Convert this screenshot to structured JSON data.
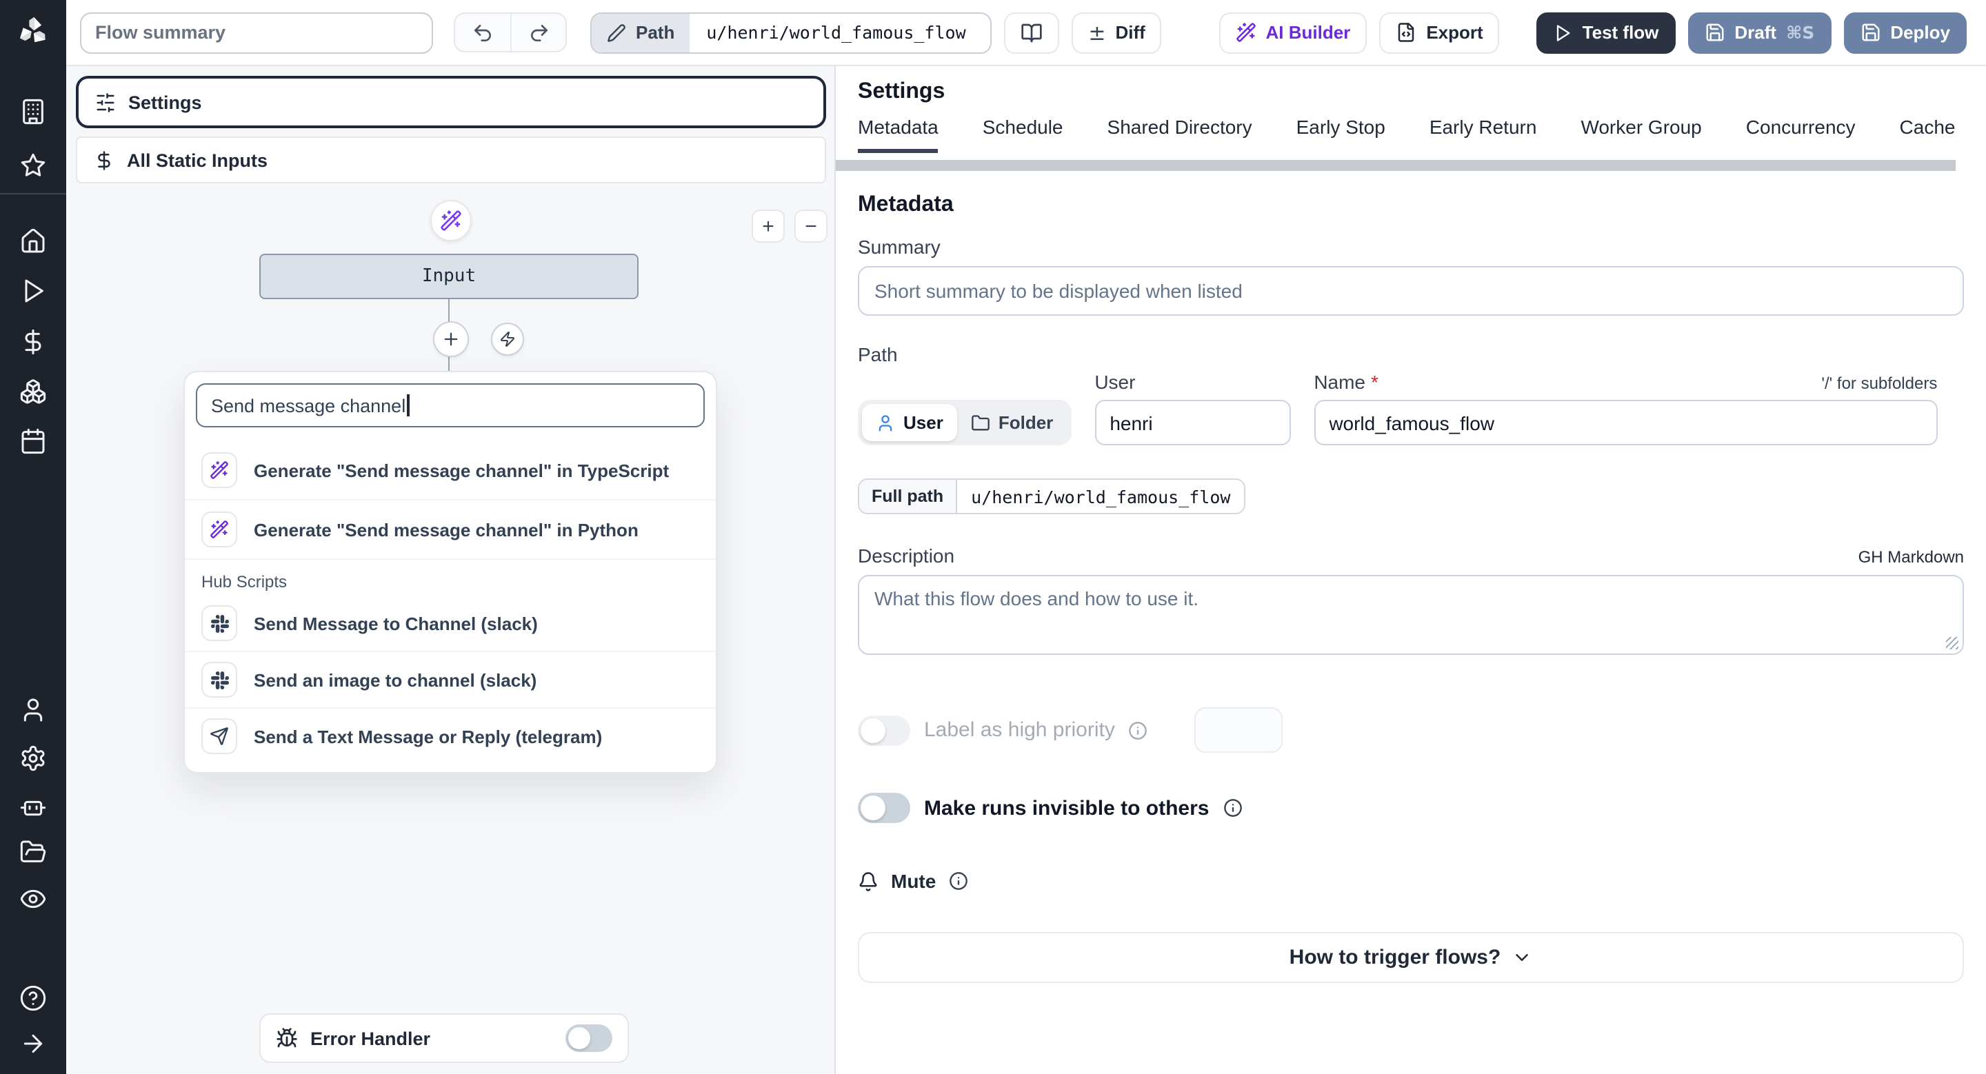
{
  "colors": {
    "sidebar_bg": "#1e232b",
    "canvas_bg": "#f6f7f9",
    "accent_purple": "#6d28d9",
    "primary_dark_button": "#2b3342",
    "slate_button": "#6b82a6",
    "selected_node_border": "#1e293b",
    "input_node_fill": "#dbe1e9"
  },
  "sidebar": {
    "icons": [
      "windmill-logo",
      "building",
      "star",
      "home",
      "play",
      "dollar",
      "boxes",
      "calendar",
      "user",
      "settings-gear",
      "bot",
      "folder-open",
      "eye",
      "help-circle",
      "expand-arrow"
    ]
  },
  "topbar": {
    "flow_summary_placeholder": "Flow summary",
    "path_label": "Path",
    "path_value": "u/henri/world_famous_flow",
    "diff_icon": "±",
    "diff_label": "Diff",
    "ai_builder_label": "AI Builder",
    "export_label": "Export",
    "test_flow_label": "Test flow",
    "draft_label": "Draft",
    "draft_shortcut": "⌘S",
    "deploy_label": "Deploy"
  },
  "flow_editor": {
    "settings_label": "Settings",
    "static_inputs_label": "All Static Inputs",
    "input_node_label": "Input",
    "zoom_in": "+",
    "zoom_out": "−",
    "search_value": "Send message channel",
    "results": [
      {
        "label": "Generate \"Send message channel\" in TypeScript",
        "icon": "wand-sparkles"
      },
      {
        "label": "Generate \"Send message channel\" in Python",
        "icon": "wand-sparkles"
      }
    ],
    "hub_section_label": "Hub Scripts",
    "hub_results": [
      {
        "label": "Send Message to Channel (slack)",
        "icon": "slack"
      },
      {
        "label": "Send an image to channel (slack)",
        "icon": "slack"
      },
      {
        "label": "Send a Text Message or Reply (telegram)",
        "icon": "send"
      }
    ],
    "error_handler_label": "Error Handler"
  },
  "settings_panel": {
    "title": "Settings",
    "tabs": [
      "Metadata",
      "Schedule",
      "Shared Directory",
      "Early Stop",
      "Early Return",
      "Worker Group",
      "Concurrency",
      "Cache"
    ],
    "active_tab": "Metadata",
    "metadata": {
      "heading": "Metadata",
      "summary_label": "Summary",
      "summary_placeholder": "Short summary to be displayed when listed",
      "path_label": "Path",
      "owner_kind_user": "User",
      "owner_kind_folder": "Folder",
      "user_label": "User",
      "user_value": "henri",
      "name_label": "Name",
      "required_marker": "*",
      "name_value": "world_famous_flow",
      "subfolders_hint": "'/' for subfolders",
      "full_path_label": "Full path",
      "full_path_value": "u/henri/world_famous_flow",
      "description_label": "Description",
      "markdown_hint": "GH Markdown",
      "description_placeholder": "What this flow does and how to use it.",
      "high_priority_label": "Label as high priority",
      "invisible_runs_label": "Make runs invisible to others",
      "mute_label": "Mute",
      "trigger_help_label": "How to trigger flows?"
    }
  }
}
